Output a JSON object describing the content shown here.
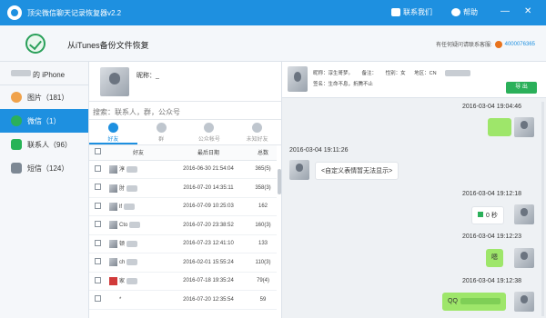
{
  "titlebar": {
    "title": "顶尖微信聊天记录恢复器v2.2",
    "contact_label": "联系我们",
    "help_label": "帮助",
    "min": "—",
    "close": "✕"
  },
  "subheader": {
    "source": "从iTunes备份文件恢复",
    "help_text": "有任何疑问请联系客服:",
    "qq": "4000076365"
  },
  "sidebar": {
    "device": "的 iPhone",
    "items": [
      {
        "label": "图片（181）",
        "icon": "photos-icon",
        "color": "#f0a24b"
      },
      {
        "label": "微信（1）",
        "icon": "wechat-icon",
        "color": "#2bb05a"
      },
      {
        "label": "联系人（96）",
        "icon": "contacts-icon",
        "color": "#27b356"
      },
      {
        "label": "短信（124）",
        "icon": "sms-icon",
        "color": "#7d8894"
      }
    ]
  },
  "list": {
    "nickname_label": "昵称：_",
    "search_placeholder": "搜索：联系人，群，公众号",
    "tabs": [
      "好友",
      "群",
      "公众帐号",
      "未知好友"
    ],
    "columns": [
      "好友",
      "最后日期",
      "总数"
    ],
    "rows": [
      {
        "name": "淳",
        "date": "2016-06-30 21:54:04",
        "count": "365(5)"
      },
      {
        "name": "肘",
        "date": "2016-07-20 14:35:11",
        "count": "358(3)"
      },
      {
        "name": "lf",
        "date": "2016-07-09 10:25:03",
        "count": "162"
      },
      {
        "name": "Cto",
        "date": "2016-07-20 23:38:52",
        "count": "160(3)"
      },
      {
        "name": "顿",
        "date": "2016-07-23 12:41:10",
        "count": "133"
      },
      {
        "name": "ch",
        "date": "2016-02-01 15:55:24",
        "count": "110(3)"
      },
      {
        "name": "家",
        "date": "2016-07-18 19:35:24",
        "count": "79(4)"
      },
      {
        "name": "*",
        "date": "2016-07-20 12:35:54",
        "count": "59"
      }
    ]
  },
  "chat": {
    "info_line1": [
      "昵称：淳生哥梦。",
      "备注：",
      "性别：女",
      "地区：CN"
    ],
    "info_line2": "签名：生命不息，折腾不止",
    "export_label": "导 出",
    "messages": {
      "ts1": "2016-03-04 19:04:46",
      "ts2": "2016-03-04 19:11:26",
      "text2": "<自定义表情暂无法显示>",
      "ts3": "2016-03-04 19:12:18",
      "text3": "0 秒",
      "ts4": "2016-03-04 19:12:23",
      "text4": "嗯",
      "ts5": "2016-03-04 19:12:38",
      "text5": "QQ"
    }
  }
}
